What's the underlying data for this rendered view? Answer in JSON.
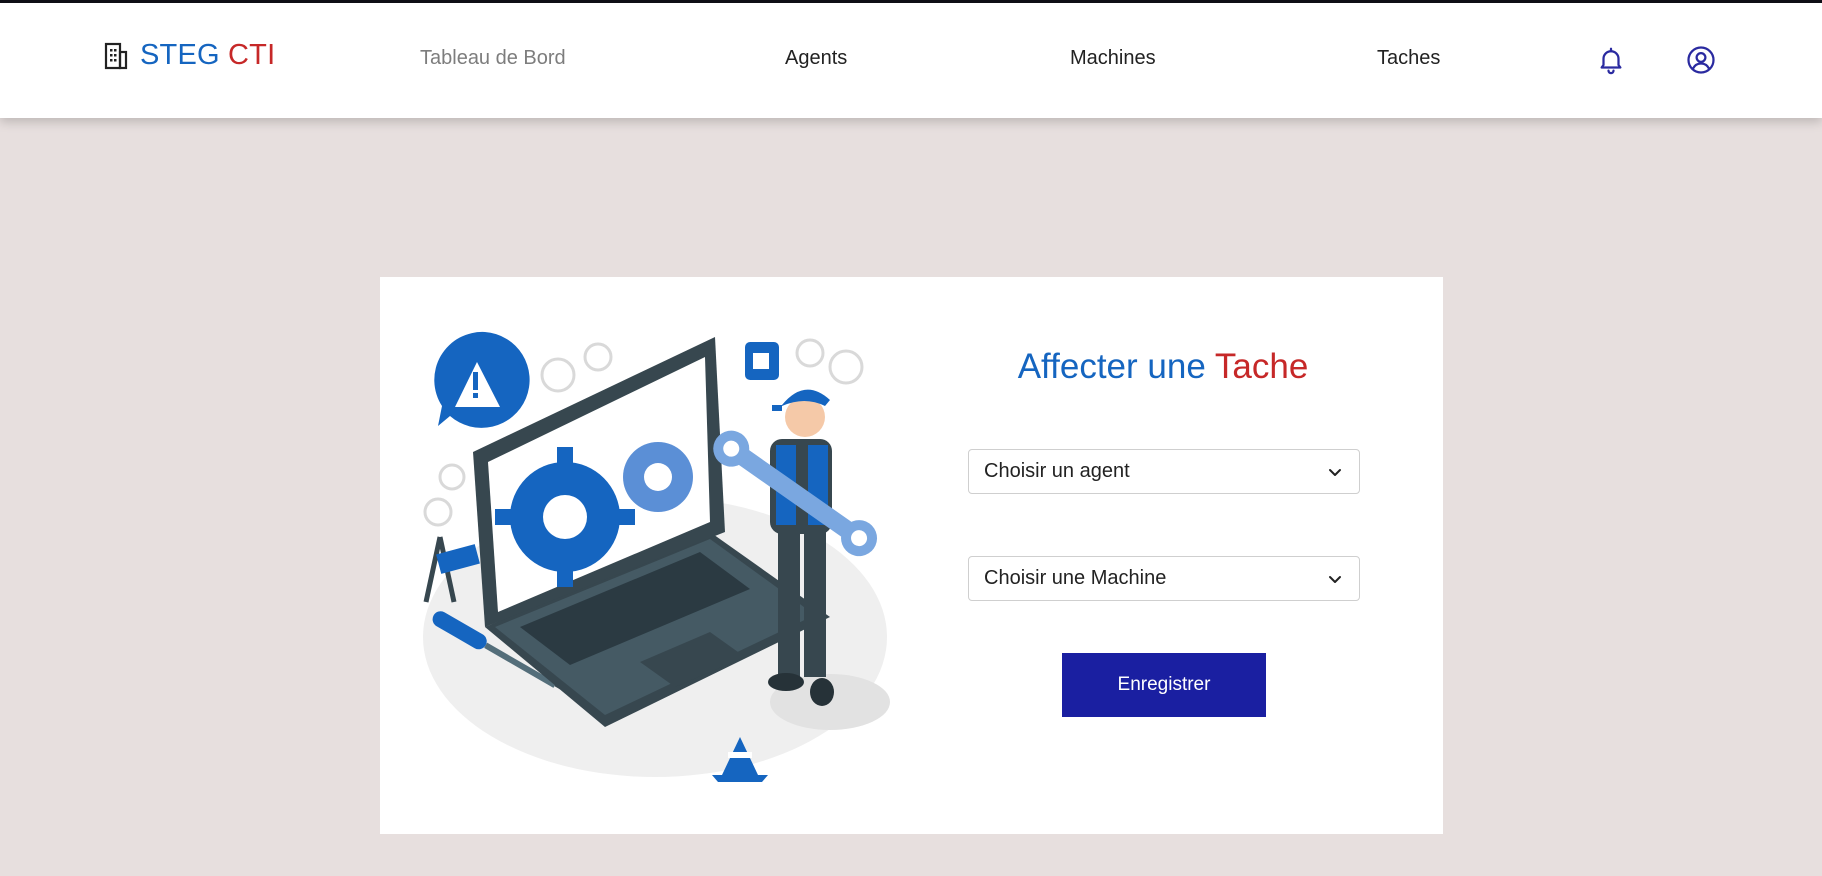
{
  "brand": {
    "steg": "STEG",
    "cti": "CTI",
    "icon": "building-icon"
  },
  "nav": {
    "items": [
      {
        "label": "Tableau de Bord"
      },
      {
        "label": "Agents"
      },
      {
        "label": "Machines"
      },
      {
        "label": "Taches"
      }
    ],
    "notification_icon": "bell-icon",
    "profile_icon": "user-circle-icon"
  },
  "form": {
    "title_part1": "Affecter une",
    "title_part2": "Tache",
    "agent_select": "Choisir un agent",
    "machine_select": "Choisir une Machine",
    "submit_label": "Enregistrer"
  },
  "colors": {
    "brand_blue": "#1565c0",
    "brand_red": "#c62828",
    "button": "#1a1fa1",
    "page_bg": "#e7dfde",
    "nav_icon": "#2a2aa0"
  }
}
